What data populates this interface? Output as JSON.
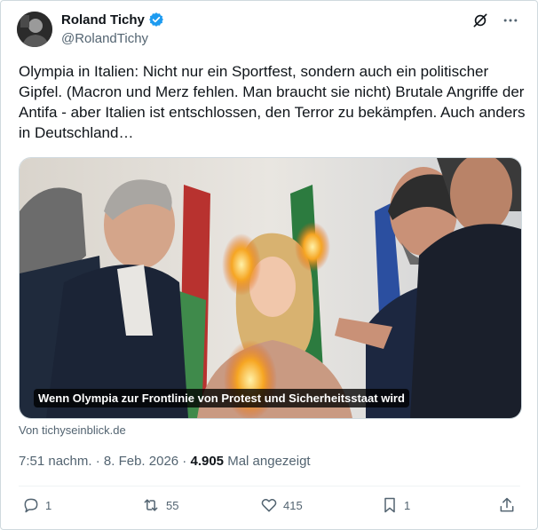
{
  "author": {
    "name": "Roland Tichy",
    "handle": "@RolandTichy",
    "verified": true
  },
  "icons": {
    "verified": "verified-badge-icon",
    "grok": "grok-icon",
    "more": "more-options-icon"
  },
  "tweet": {
    "text": "Olympia in Italien: Nicht nur ein Sportfest, sondern auch ein politischer Gipfel. (Macron und Merz fehlen. Man braucht sie nicht) Brutale Angriffe der Antifa - aber Italien ist entschlossen, den Terror zu bekämpfen. Auch anders in Deutschland…"
  },
  "media": {
    "caption": "Wenn Olympia zur Frontlinie von Protest und Sicherheitsstaat wird",
    "source": "Von tichyseinblick.de"
  },
  "meta": {
    "time": "7:51 nachm.",
    "separator": " · ",
    "date": "8. Feb. 2026",
    "separator2": " · ",
    "views": "4.905",
    "views_label": " Mal angezeigt"
  },
  "actions": {
    "replies": "1",
    "reposts": "55",
    "likes": "415",
    "bookmarks": "1"
  },
  "colors": {
    "verified": "#1d9bf0",
    "muted": "#536471",
    "text": "#0f1419"
  }
}
